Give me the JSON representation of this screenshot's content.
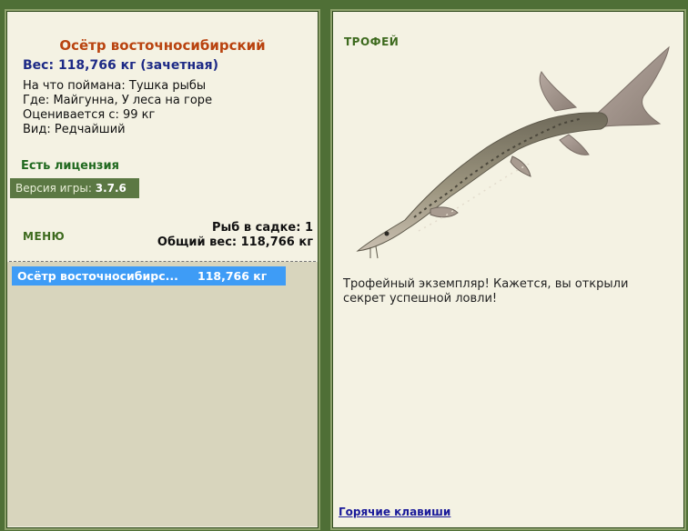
{
  "fish": {
    "title": "Осётр восточносибирский",
    "weight": "Вес: 118,766 кг (зачетная)",
    "info": [
      {
        "label": "На что поймана:",
        "value": "Тушка рыбы"
      },
      {
        "label": "Где:",
        "value": "Майгунна, У леса на горе"
      },
      {
        "label": "Оценивается с:",
        "value": "99 кг"
      },
      {
        "label": "Вид:",
        "value": "Редчайший"
      }
    ],
    "license": "Есть лицензия"
  },
  "version": {
    "label": "Версия игры:",
    "value": "3.7.6"
  },
  "menu_label": "МЕНЮ",
  "stats": {
    "fish_count": "Рыб в садке: 1",
    "total_weight": "Общий вес: 118,766 кг"
  },
  "catch_list": [
    {
      "name": "Осётр восточносибирс...",
      "weight": "118,766 кг"
    }
  ],
  "trophy": {
    "heading": "ТРОФЕЙ",
    "text": "Трофейный экземпляр! Кажется, вы открыли секрет успешной ловли!"
  },
  "hotkeys_link": "Горячие клавиши",
  "colors": {
    "background": "#4f6f36",
    "panel": "#f4f2e3",
    "title": "#b9430f",
    "weight": "#1d2a86",
    "license": "#20691f",
    "selected_row": "#3e9cf6"
  },
  "icons": {
    "fish_image": "sturgeon-image"
  }
}
